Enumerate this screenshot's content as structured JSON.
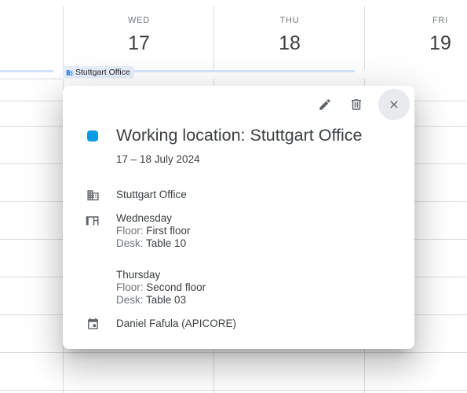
{
  "calendar": {
    "days": [
      {
        "dow": "WED",
        "date": "17"
      },
      {
        "dow": "THU",
        "date": "18"
      },
      {
        "dow": "FRI",
        "date": "19"
      }
    ],
    "location_chip": "Stuttgart Office"
  },
  "popup": {
    "actions": {
      "edit_icon": "pencil-icon",
      "delete_icon": "trash-icon",
      "close_icon": "close-icon"
    },
    "color": "#039be5",
    "title": "Working location: Stuttgart Office",
    "dates": "17 – 18 July 2024",
    "office": "Stuttgart Office",
    "wednesday": {
      "day": "Wednesday",
      "floor_label": "Floor:",
      "floor": "First floor",
      "desk_label": "Desk:",
      "desk": "Table 10"
    },
    "thursday": {
      "day": "Thursday",
      "floor_label": "Floor:",
      "floor": "Second floor",
      "desk_label": "Desk:",
      "desk": "Table 03"
    },
    "calendar_owner": "Daniel Fafula (APICORE)"
  }
}
